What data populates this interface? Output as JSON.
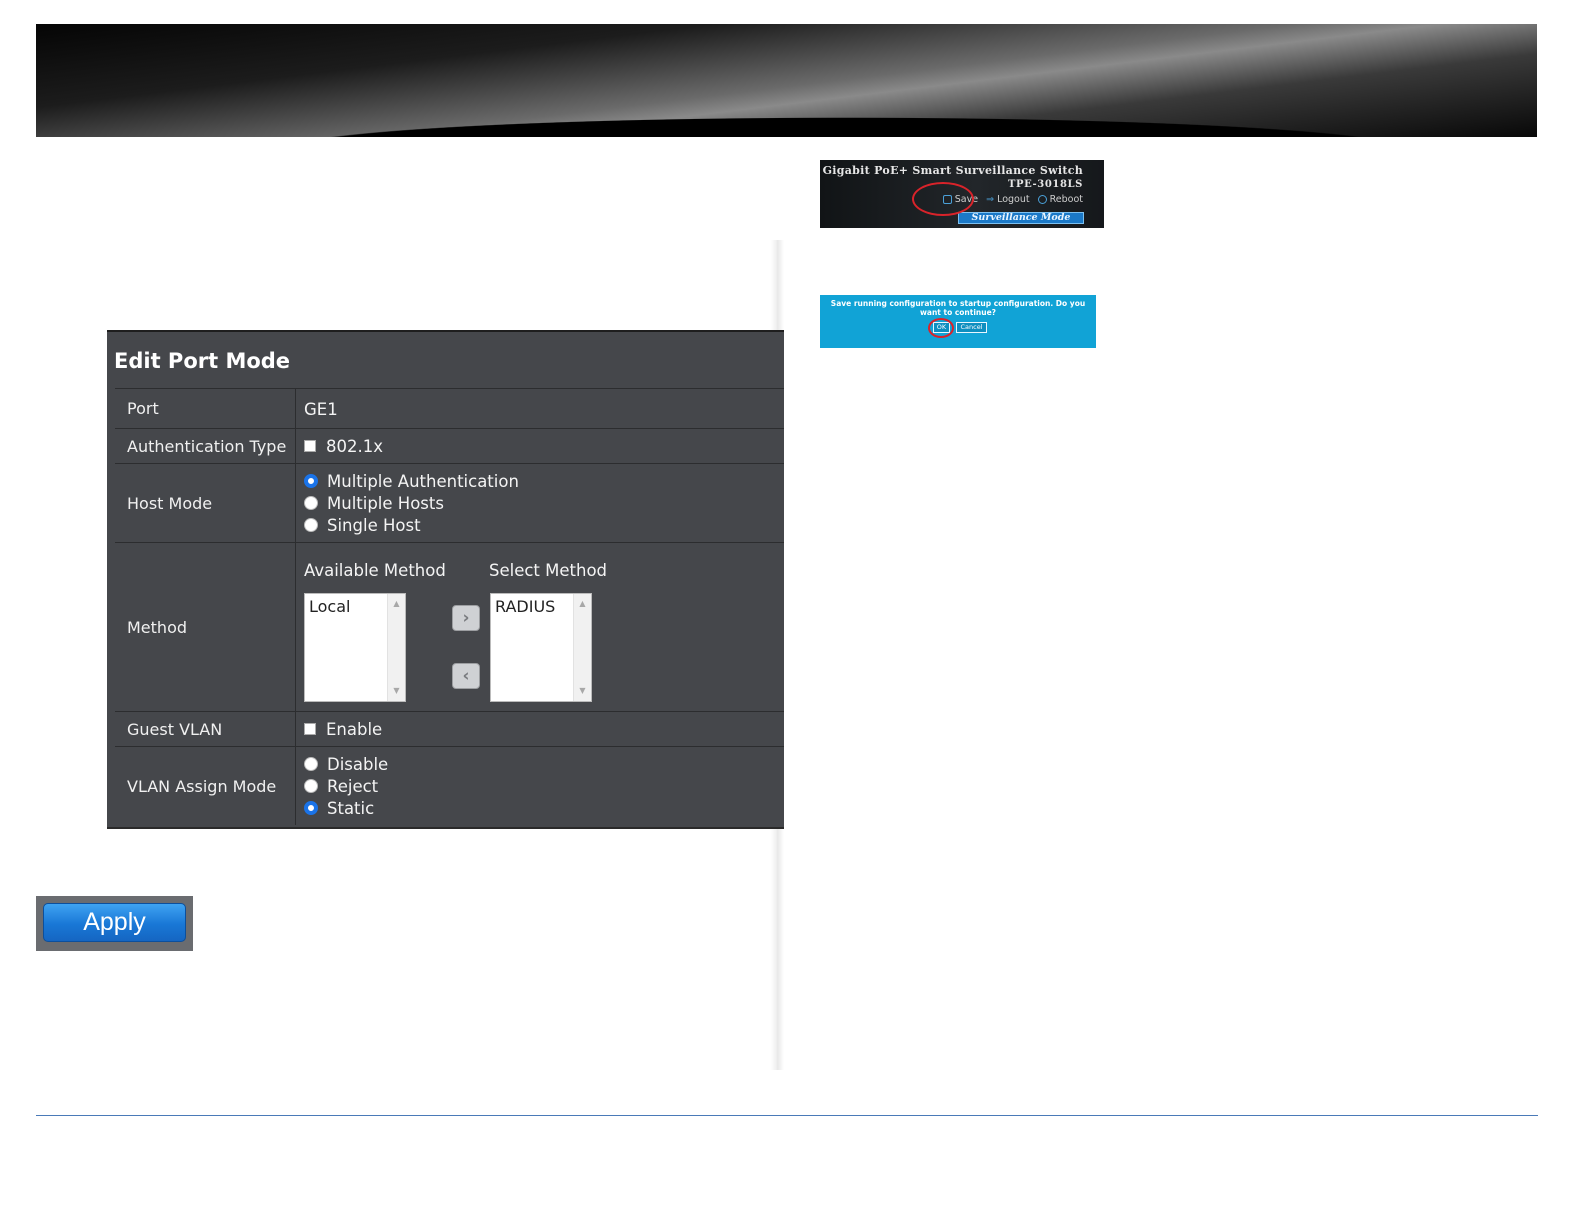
{
  "edit_port_mode": {
    "title": "Edit Port Mode",
    "port": {
      "label": "Port",
      "value": "GE1"
    },
    "authentication_type": {
      "label": "Authentication Type",
      "option": "802.1x",
      "checked": false
    },
    "host_mode": {
      "label": "Host Mode",
      "options": [
        {
          "label": "Multiple Authentication",
          "selected": true
        },
        {
          "label": "Multiple Hosts",
          "selected": false
        },
        {
          "label": "Single Host",
          "selected": false
        }
      ]
    },
    "method": {
      "label": "Method",
      "available_header": "Available Method",
      "selected_header": "Select Method",
      "available_items": [
        "Local"
      ],
      "selected_items": [
        "RADIUS"
      ]
    },
    "guest_vlan": {
      "label": "Guest VLAN",
      "option": "Enable",
      "checked": false
    },
    "vlan_assign_mode": {
      "label": "VLAN Assign Mode",
      "options": [
        {
          "label": "Disable",
          "selected": false
        },
        {
          "label": "Reject",
          "selected": false
        },
        {
          "label": "Static",
          "selected": true
        }
      ]
    }
  },
  "apply_button": {
    "label": "Apply"
  },
  "header_thumbnail": {
    "product": "Gigabit PoE+ Smart Surveillance Switch",
    "model": "TPE-3018LS",
    "save": "Save",
    "logout": "Logout",
    "reboot": "Reboot",
    "mode": "Surveillance Mode"
  },
  "save_dialog": {
    "message": "Save running configuration to startup configuration. Do you want to continue?",
    "ok": "OK",
    "cancel": "Cancel"
  },
  "colors": {
    "panel_bg": "#45474b",
    "radio_selected": "#1a73e8",
    "apply_blue": "#1977d6",
    "dialog_bg": "#11a3d6",
    "highlight_red": "#d9232a"
  }
}
